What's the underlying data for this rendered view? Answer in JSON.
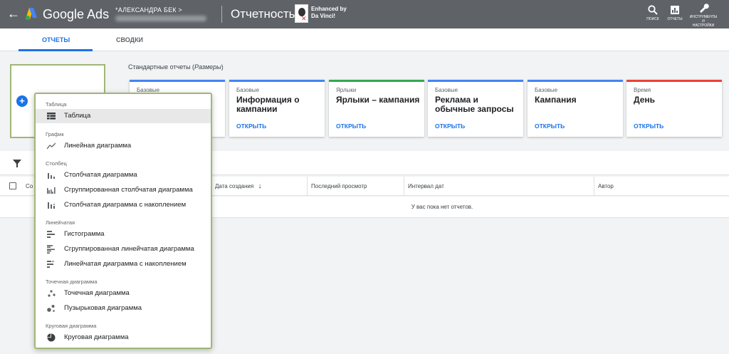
{
  "header": {
    "back_glyph": "←",
    "brand": "Google Ads",
    "account": "*АЛЕКСАНДРА БЕК  >",
    "page_title": "Отчетность",
    "enhanced_line1": "Enhanced by",
    "enhanced_line2": "Da Vinci!",
    "search_label": "ПОИСК",
    "reports_label": "ОТЧЕТЫ",
    "tools_label_1": "ИНСТРУМЕНТЫ",
    "tools_label_2": "И",
    "tools_label_3": "НАСТРОЙКИ"
  },
  "tabs": [
    {
      "label": "ОТЧЕТЫ",
      "active": true
    },
    {
      "label": "СВОДКИ",
      "active": false
    }
  ],
  "standard": {
    "title_prefix": "Стандартные отчеты (",
    "title_italic": "Размеры",
    "title_suffix": ")"
  },
  "cards": [
    {
      "category": "Базовые",
      "name": "",
      "open": "",
      "color": "#4285f4"
    },
    {
      "category": "Базовые",
      "name": "Информация о кампании",
      "open": "ОТКРЫТЬ",
      "color": "#4285f4"
    },
    {
      "category": "Ярлыки",
      "name": "Ярлыки – кампания",
      "open": "ОТКРЫТЬ",
      "color": "#34a853"
    },
    {
      "category": "Базовые",
      "name": "Реклама и обычные запросы",
      "open": "ОТКРЫТЬ",
      "color": "#4285f4"
    },
    {
      "category": "Базовые",
      "name": "Кампания",
      "open": "ОТКРЫТЬ",
      "color": "#4285f4"
    },
    {
      "category": "Время",
      "name": "День",
      "open": "ОТКРЫТЬ",
      "color": "#ea4335"
    }
  ],
  "table": {
    "col_created_partial": "Со",
    "col_created_date": "Дата создания",
    "sort_glyph": "↓",
    "col_last_view": "Последний просмотр",
    "col_date_range": "Интервал дат",
    "col_author": "Автор",
    "empty": "У вас пока нет отчетов."
  },
  "menu": {
    "groups": [
      {
        "label": "Таблица",
        "items": [
          {
            "label": "Таблица",
            "icon": "table-icon",
            "selected": true
          }
        ]
      },
      {
        "label": "График",
        "items": [
          {
            "label": "Линейная диаграмма",
            "icon": "line-chart-icon",
            "selected": false
          }
        ]
      },
      {
        "label": "Столбец",
        "items": [
          {
            "label": "Столбчатая диаграмма",
            "icon": "bar-chart-icon",
            "selected": false
          },
          {
            "label": "Сгруппированная столбчатая диаграмма",
            "icon": "grouped-bar-chart-icon",
            "selected": false
          },
          {
            "label": "Столбчатая диаграмма с накоплением",
            "icon": "stacked-bar-chart-icon",
            "selected": false
          }
        ]
      },
      {
        "label": "Линейчатая",
        "items": [
          {
            "label": "Гистограмма",
            "icon": "horizontal-bar-icon",
            "selected": false
          },
          {
            "label": "Сгруппированная линейчатая диаграмма",
            "icon": "grouped-horizontal-bar-icon",
            "selected": false
          },
          {
            "label": "Линейчатая диаграмма с накоплением",
            "icon": "stacked-horizontal-bar-icon",
            "selected": false
          }
        ]
      },
      {
        "label": "Точечная диаграмма",
        "items": [
          {
            "label": "Точечная диаграмма",
            "icon": "scatter-chart-icon",
            "selected": false
          },
          {
            "label": "Пузырьковая диаграмма",
            "icon": "bubble-chart-icon",
            "selected": false
          }
        ]
      },
      {
        "label": "Круговая диаграмма",
        "items": [
          {
            "label": "Круговая диаграмма",
            "icon": "pie-chart-icon",
            "selected": false
          }
        ]
      }
    ]
  },
  "colors": {
    "header_bg": "#5f6368",
    "accent_blue": "#1a73e8",
    "highlight_border": "#a0b776"
  }
}
